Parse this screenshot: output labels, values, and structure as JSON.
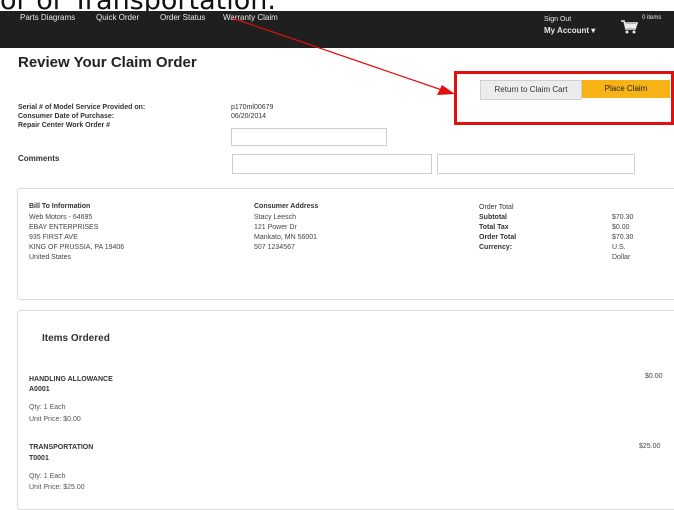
{
  "caption": "or or Transportation.",
  "nav": {
    "items": [
      "Parts Diagrams",
      "Quick Order",
      "Order Status",
      "Warranty Claim"
    ],
    "sign_out": "Sign Out",
    "my_account": "My Account",
    "cart_items": "0 items"
  },
  "page": {
    "title": "Review Your Claim Order",
    "return_button": "Return to Claim Cart",
    "place_button": "Place Claim"
  },
  "claim_fields": {
    "serial_label": "Serial # of Model Service Provided on:",
    "serial_value": "p170ml00679",
    "purchase_label": "Consumer Date of Purchase:",
    "purchase_value": "06/20/2014",
    "work_order_label": "Repair Center Work Order #",
    "work_order_value": "",
    "comments_label": "Comments",
    "comments_value_1": "",
    "comments_value_2": ""
  },
  "bill_to": {
    "heading": "Bill To Information",
    "line1": "Web Motors  -  64695",
    "line2": "EBAY ENTERPRISES",
    "line3": "935 FIRST AVE",
    "line4": "KING OF PRUSSIA, PA  19406",
    "line5": "United States"
  },
  "consumer": {
    "heading": "Consumer Address",
    "line1": "Stacy Leesch",
    "line2": "121 Power Dr",
    "line3": "Mankato, MN 56001",
    "line4": "507 1234567"
  },
  "order_total": {
    "heading": "Order Total",
    "subtotal_label": "Subtotal",
    "subtotal_value": "$70.30",
    "tax_label": "Total Tax",
    "tax_value": "$0.00",
    "total_label": "Order Total",
    "total_value": "$70.30",
    "currency_label": "Currency:",
    "currency_value_1": "U.S.",
    "currency_value_2": "Dollar"
  },
  "items_ordered": {
    "heading": "Items Ordered",
    "items": [
      {
        "name": "HANDLING ALLOWANCE",
        "code": "A0001",
        "qty": "Qty: 1  Each",
        "unit_price": "Unit Price: $0.00",
        "price": "$0.00"
      },
      {
        "name": "TRANSPORTATION",
        "code": "T0001",
        "qty": "Qty: 1  Each",
        "unit_price": "Unit Price: $25.00",
        "price": "$25.00"
      }
    ]
  },
  "colors": {
    "nav_bg": "#1f1f1f",
    "accent": "#f7b315",
    "highlight": "#e01010"
  }
}
